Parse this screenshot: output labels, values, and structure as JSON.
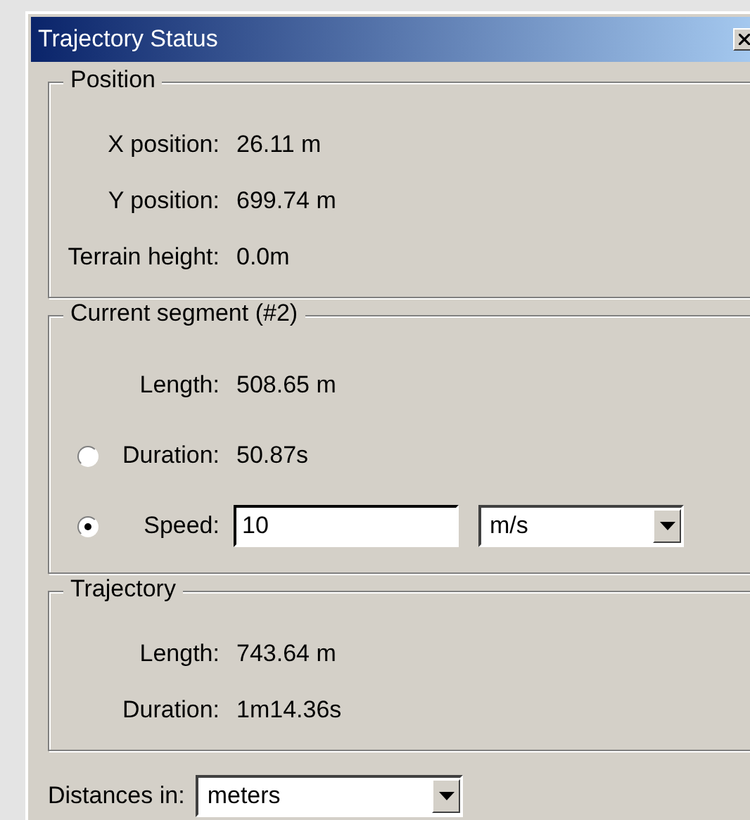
{
  "window": {
    "title": "Trajectory Status"
  },
  "groups": [
    {
      "title": "Position",
      "rows": [
        {
          "kind": "readout",
          "label": "X position:",
          "value": "26.11 m"
        },
        {
          "kind": "readout",
          "label": "Y position:",
          "value": "699.74 m"
        },
        {
          "kind": "readout",
          "label": "Terrain height:",
          "value": "0.0m"
        }
      ]
    },
    {
      "title": "Current segment (#2)",
      "rows": [
        {
          "kind": "readout",
          "label": "Length:",
          "value": "508.65 m"
        },
        {
          "kind": "radio-readout",
          "selected": false,
          "label": "Duration:",
          "value": "50.87s"
        },
        {
          "kind": "radio-input",
          "selected": true,
          "label": "Speed:",
          "value": "10",
          "unit": "m/s"
        }
      ]
    },
    {
      "title": "Trajectory",
      "rows": [
        {
          "kind": "readout",
          "label": "Length:",
          "value": "743.64 m"
        },
        {
          "kind": "readout",
          "label": "Duration:",
          "value": "1m14.36s"
        }
      ]
    }
  ],
  "distances": {
    "label": "Distances in:",
    "value": "meters"
  }
}
